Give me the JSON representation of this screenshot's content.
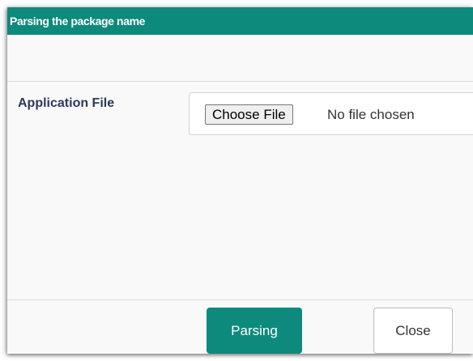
{
  "dialog": {
    "title": "Parsing the package name",
    "accent_color": "#0d8a7c"
  },
  "form": {
    "field_label": "Application File",
    "choose_file_label": "Choose File",
    "file_status": "No file chosen"
  },
  "footer": {
    "primary_button_label": "Parsing",
    "secondary_button_label": "Close"
  }
}
